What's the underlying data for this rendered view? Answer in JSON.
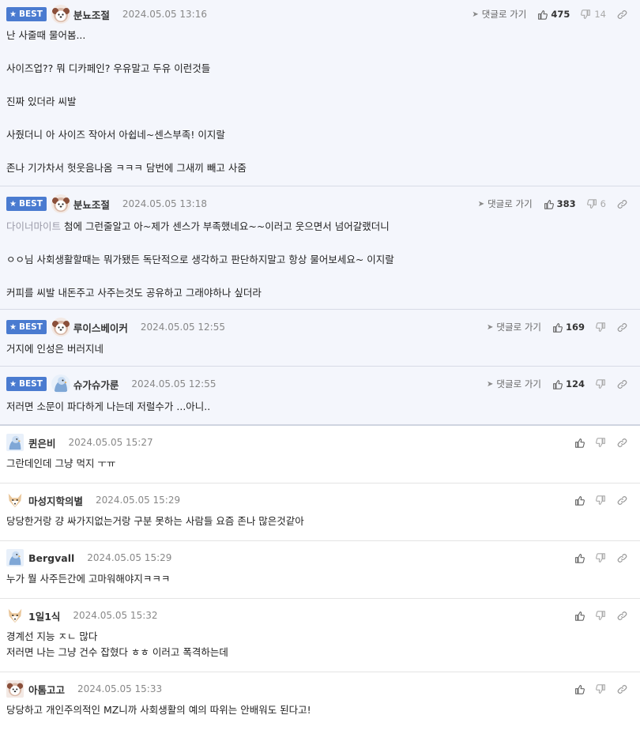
{
  "labels": {
    "best": "BEST",
    "reply": "댓글로 가기"
  },
  "best_comments": [
    {
      "nick": "분뇨조절",
      "date": "2024.05.05 13:16",
      "likes": "475",
      "dislikes": "14",
      "avatar": "puppy",
      "paragraphs": [
        "난 사줄때 물어봄...",
        "사이즈업?? 뭐 디카페인? 우유말고 두유 이런것들",
        "진짜 있더라 씨발",
        "사줬더니 아 사이즈 작아서 아쉽네~센스부족! 이지랄",
        "존나 기가차서 헛웃음나옴 ㅋㅋㅋ 담번에 그새끼 빼고 사줌"
      ]
    },
    {
      "nick": "분뇨조절",
      "date": "2024.05.05 13:18",
      "likes": "383",
      "dislikes": "6",
      "avatar": "puppy",
      "mention": "다이너마이트",
      "first_line": " 첨에 그런줄알고 아~제가 센스가 부족했네요~~이러고 웃으면서 넘어갈랬더니",
      "paragraphs": [
        "ㅇㅇ님 사회생활할때는 뭐가됐든 독단적으로 생각하고 판단하지말고 항상 물어보세요~ 이지랄",
        "커피를 씨발 내돈주고 사주는것도 공유하고 그래야하나 싶더라"
      ]
    },
    {
      "nick": "루이스베이커",
      "date": "2024.05.05 12:55",
      "likes": "169",
      "avatar": "puppy",
      "paragraphs": [
        "거지에 인성은 버러지네"
      ]
    },
    {
      "nick": "슈가슈가룬",
      "date": "2024.05.05 12:55",
      "likes": "124",
      "avatar": "pigeon",
      "paragraphs": [
        "저러면 소문이 파다하게 나는데 저럴수가 ...아니.."
      ]
    }
  ],
  "comments": [
    {
      "nick": "퀸은비",
      "date": "2024.05.05 15:27",
      "avatar": "pigeon",
      "lines": [
        "그란데인데 그냥 먹지 ㅜㅠ"
      ]
    },
    {
      "nick": "마성지학의별",
      "date": "2024.05.05 15:29",
      "avatar": "fox",
      "lines": [
        "당당한거랑 걍 싸가지없는거랑 구분 못하는 사람들 요즘 존나 많은것같아"
      ]
    },
    {
      "nick": "Bergvall",
      "date": "2024.05.05 15:29",
      "avatar": "pigeon",
      "lines": [
        "누가 뭘 사주든간에 고마워해야지ㅋㅋㅋ"
      ]
    },
    {
      "nick": "1일1식",
      "date": "2024.05.05 15:32",
      "avatar": "fox",
      "lines": [
        "경계선 지능 ㅈㄴ 많다",
        "저러면 나는 그냥 건수 잡혔다 ㅎㅎ 이러고 폭격하는데"
      ]
    },
    {
      "nick": "아톰고고",
      "date": "2024.05.05 15:33",
      "avatar": "puppy",
      "lines": [
        "당당하고 개인주의적인 MZ니까 사회생활의 예의 따위는 안배워도 된다고!"
      ]
    }
  ]
}
